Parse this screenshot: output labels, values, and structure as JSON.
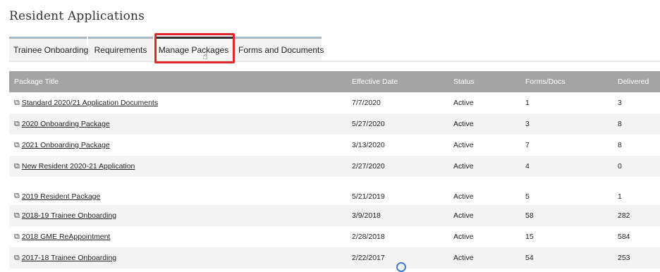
{
  "page": {
    "title": "Resident Applications"
  },
  "tabs": [
    {
      "label": "Trainee Onboarding"
    },
    {
      "label": "Requirements"
    },
    {
      "label": "Manage Packages"
    },
    {
      "label": "Forms and Documents"
    }
  ],
  "table": {
    "headers": [
      "Package Title",
      "Effective Date",
      "Status",
      "Forms/Docs",
      "Delivered"
    ],
    "rows": [
      {
        "title": "Standard 2020/21 Application Documents",
        "date": "7/7/2020",
        "status": "Active",
        "forms": "1",
        "delivered": "3"
      },
      {
        "title": "2020 Onboarding Package",
        "date": "5/27/2020",
        "status": "Active",
        "forms": "3",
        "delivered": "8"
      },
      {
        "title": "2021 Onboarding Package",
        "date": "3/13/2020",
        "status": "Active",
        "forms": "7",
        "delivered": "8"
      },
      {
        "title": "New Resident 2020-21 Application",
        "date": "2/27/2020",
        "status": "Active",
        "forms": "4",
        "delivered": "0"
      },
      {
        "title": "2019 Resident Package",
        "date": "5/21/2019",
        "status": "Active",
        "forms": "5",
        "delivered": "1"
      },
      {
        "title": "2018-19 Trainee Onboarding",
        "date": "3/9/2018",
        "status": "Active",
        "forms": "58",
        "delivered": "282"
      },
      {
        "title": "2018 GME ReAppointment",
        "date": "2/28/2018",
        "status": "Active",
        "forms": "15",
        "delivered": "584"
      },
      {
        "title": "2017-18 Trainee Onboarding",
        "date": "2/22/2017",
        "status": "Active",
        "forms": "54",
        "delivered": "253"
      }
    ]
  },
  "icons": {
    "copy": "copy-icon",
    "cursor": "hand-pointer-icon"
  },
  "colors": {
    "highlight": "#e02a2a",
    "header_bg": "#a4a4a4",
    "tab_active_bar": "#2f2f2f"
  }
}
